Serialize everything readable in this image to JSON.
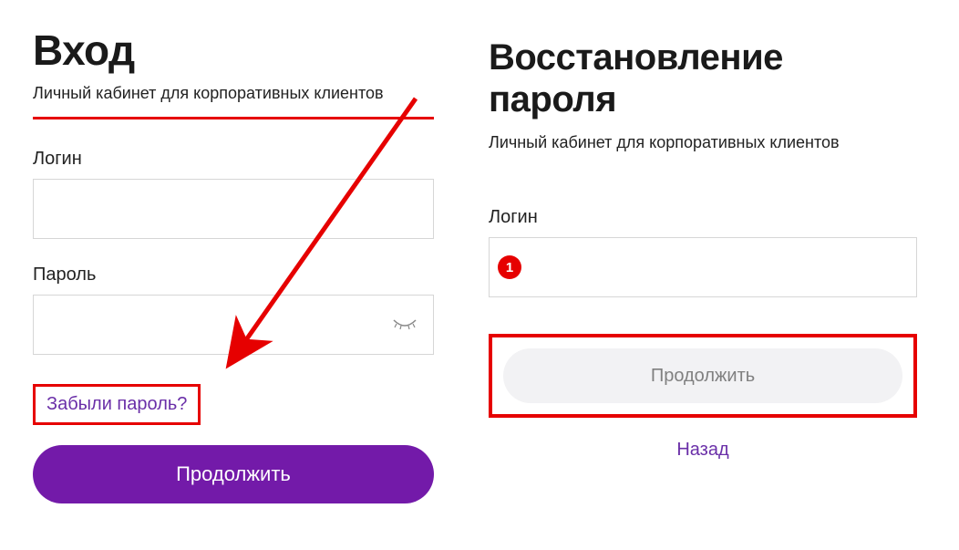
{
  "left": {
    "title": "Вход",
    "subtitle": "Личный кабинет для корпоративных клиентов",
    "login_label": "Логин",
    "password_label": "Пароль",
    "forgot_label": "Забыли пароль?",
    "continue_label": "Продолжить"
  },
  "right": {
    "title": "Восстановление пароля",
    "subtitle": "Личный кабинет для корпоративных клиентов",
    "login_label": "Логин",
    "badge": "1",
    "continue_label": "Продолжить",
    "back_label": "Назад"
  },
  "annotations": {
    "color": "#e60000"
  }
}
